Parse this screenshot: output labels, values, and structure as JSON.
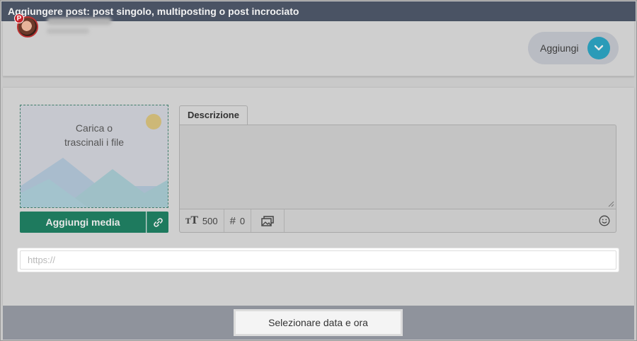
{
  "dialog": {
    "title": "Aggiungere post: post singolo, multiposting o post incrociato"
  },
  "account": {
    "network_badge": "P",
    "add_button_label": "Aggiungi"
  },
  "media": {
    "dropzone_line1": "Carica o",
    "dropzone_line2": "trascinali i file",
    "add_media_label": "Aggiungi media"
  },
  "editor": {
    "tab_label": "Descrizione",
    "char_count": "500",
    "hashtag_count": "0"
  },
  "link": {
    "placeholder": "https://"
  },
  "footer": {
    "schedule_label": "Selezionare data e ora"
  },
  "colors": {
    "titlebar": "#4a5364",
    "accent_teal": "#2a9bb8",
    "media_green": "#1e7a5e"
  }
}
